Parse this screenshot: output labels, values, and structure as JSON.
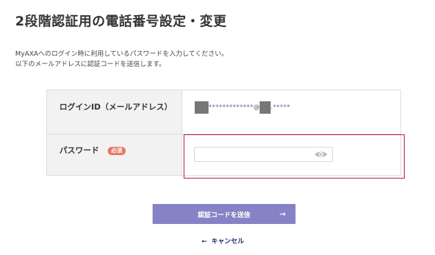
{
  "page": {
    "title": "2段階認証用の電話番号設定・変更",
    "description_line1": "MyAXAへのログイン時に利用しているパスワードを入力してください。",
    "description_line2": "以下のメールアドレスに認証コードを送信します。"
  },
  "form": {
    "login_id": {
      "label": "ログインID（メールアドレス）",
      "value_stars_1": "*************",
      "value_at": "@",
      "value_stars_2": ".*****"
    },
    "password": {
      "label": "パスワード",
      "required_badge": "必須",
      "value": "",
      "placeholder": ""
    }
  },
  "actions": {
    "submit_label": "認証コードを送信",
    "submit_arrow": "→",
    "cancel_arrow": "←",
    "cancel_label": "キャンセル"
  },
  "colors": {
    "submit_button": "#8583c6",
    "required_badge": "#e87560",
    "error_outline": "#b3142f",
    "cancel_link": "#2d2d6e"
  },
  "icons": {
    "eye": "eye-icon",
    "submit_arrow": "arrow-right-icon",
    "cancel_arrow": "arrow-left-icon"
  }
}
